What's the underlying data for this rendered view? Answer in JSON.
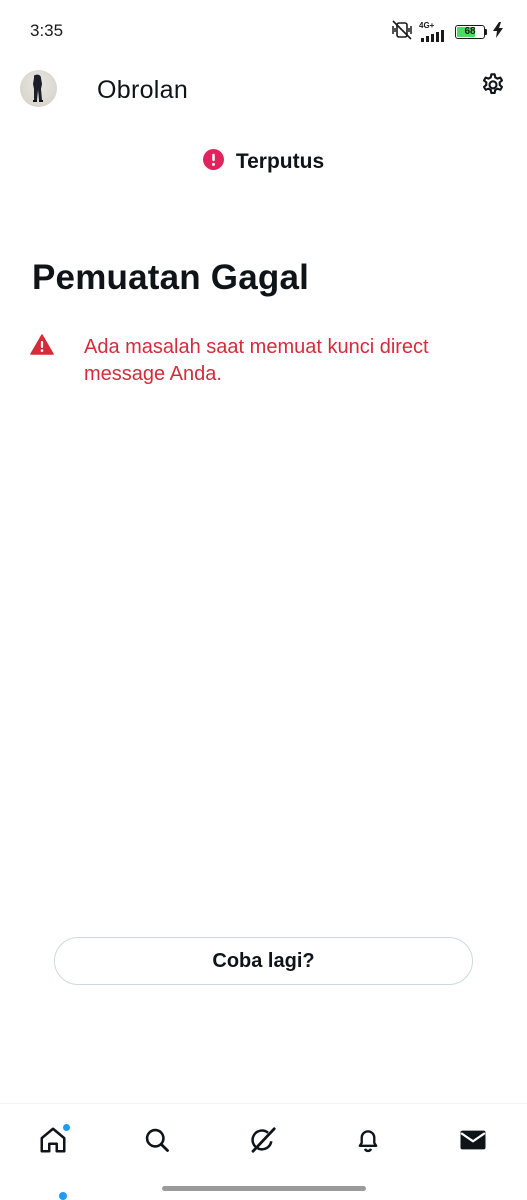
{
  "status_bar": {
    "time": "3:35",
    "network": "4G+",
    "battery_level": "68",
    "battery_fraction": 0.68
  },
  "header": {
    "title": "Obrolan",
    "avatar_icon": "user-avatar",
    "settings_icon": "gear-icon"
  },
  "connection": {
    "status_text": "Terputus",
    "icon": "alert-circle-icon",
    "icon_color": "#e0245e"
  },
  "error": {
    "title": "Pemuatan Gagal",
    "message": "Ada masalah saat memuat kunci direct message Anda.",
    "icon": "warning-triangle-icon",
    "color": "#d42c3a"
  },
  "retry": {
    "label": "Coba lagi?"
  },
  "bottom_nav": {
    "items": [
      {
        "icon": "home-icon",
        "has_dot": true
      },
      {
        "icon": "search-icon",
        "has_dot": false
      },
      {
        "icon": "grok-icon",
        "has_dot": false
      },
      {
        "icon": "bell-icon",
        "has_dot": false
      },
      {
        "icon": "mail-icon",
        "has_dot": false,
        "active": true
      }
    ],
    "accent": "#1d9bf0"
  }
}
